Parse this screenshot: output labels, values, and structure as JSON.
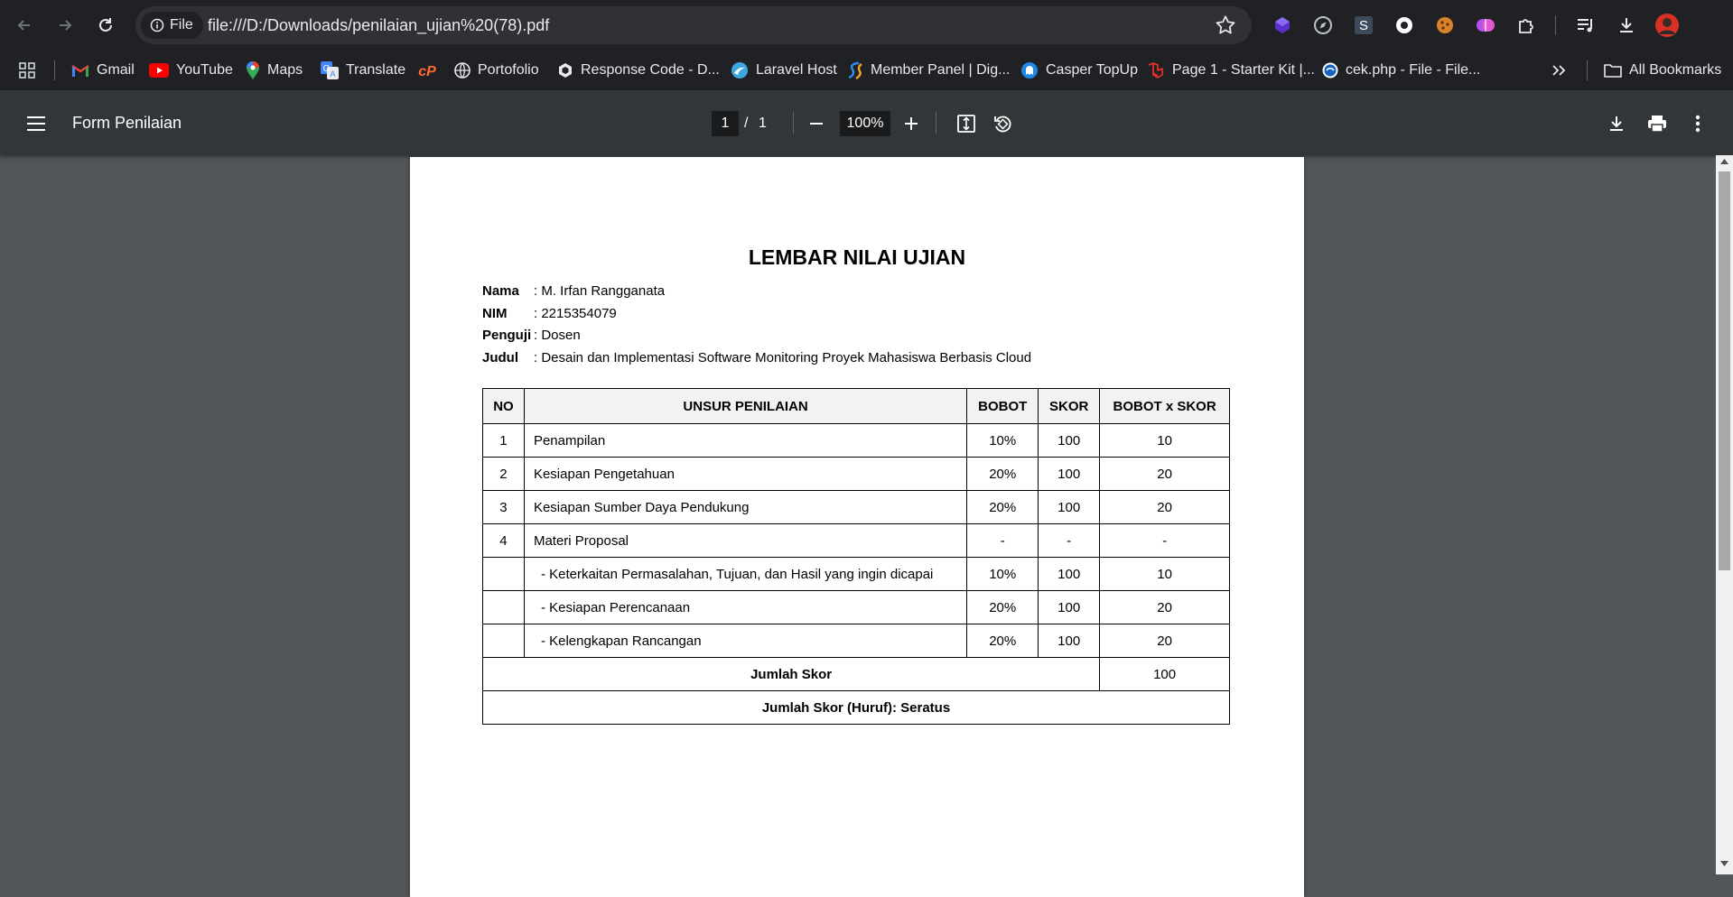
{
  "browser": {
    "url_chip": "File",
    "url": "file:///D:/Downloads/penilaian_ujian%20(78).pdf"
  },
  "bookmarks": {
    "items": [
      {
        "label": "Gmail",
        "icon": "gmail-icon"
      },
      {
        "label": "YouTube",
        "icon": "youtube-icon"
      },
      {
        "label": "Maps",
        "icon": "maps-icon"
      },
      {
        "label": "Translate",
        "icon": "translate-icon"
      },
      {
        "label": "",
        "icon": "cpanel-icon"
      },
      {
        "label": "Portofolio",
        "icon": "globe-icon"
      },
      {
        "label": "Response Code - D...",
        "icon": "response-code-icon"
      },
      {
        "label": "Laravel Host",
        "icon": "laravel-host-icon"
      },
      {
        "label": "Member Panel | Dig...",
        "icon": "member-panel-icon"
      },
      {
        "label": "Casper TopUp",
        "icon": "casper-icon"
      },
      {
        "label": "Page 1 - Starter Kit |...",
        "icon": "laravel-icon"
      },
      {
        "label": "cek.php - File - File...",
        "icon": "file-icon"
      }
    ],
    "all_bookmarks": "All Bookmarks"
  },
  "pdf_toolbar": {
    "title": "Form Penilaian",
    "page_current": "1",
    "page_separator": "/",
    "page_total": "1",
    "zoom": "100%"
  },
  "document": {
    "heading": "LEMBAR NILAI UJIAN",
    "fields": [
      {
        "label": "Nama",
        "value": ": M. Irfan Rangganata"
      },
      {
        "label": "NIM",
        "value": ": 2215354079"
      },
      {
        "label": "Penguji",
        "value": ": Dosen"
      },
      {
        "label": "Judul",
        "value": ": Desain dan Implementasi Software Monitoring Proyek Mahasiswa Berbasis Cloud"
      }
    ],
    "table": {
      "headers": [
        "NO",
        "UNSUR PENILAIAN",
        "BOBOT",
        "SKOR",
        "BOBOT x SKOR"
      ],
      "rows": [
        [
          "1",
          "Penampilan",
          "10%",
          "100",
          "10"
        ],
        [
          "2",
          "Kesiapan Pengetahuan",
          "20%",
          "100",
          "20"
        ],
        [
          "3",
          "Kesiapan Sumber Daya Pendukung",
          "20%",
          "100",
          "20"
        ],
        [
          "4",
          "Materi Proposal",
          "-",
          "-",
          "-"
        ],
        [
          "",
          "- Keterkaitan Permasalahan, Tujuan, dan Hasil yang ingin dicapai",
          "10%",
          "100",
          "10"
        ],
        [
          "",
          "- Kesiapan Perencanaan",
          "20%",
          "100",
          "20"
        ],
        [
          "",
          "- Kelengkapan Rancangan",
          "20%",
          "100",
          "20"
        ]
      ],
      "total_label": "Jumlah Skor",
      "total_value": "100",
      "total_words": "Jumlah Skor (Huruf): Seratus"
    }
  },
  "colors": {
    "browser_bg": "#202124",
    "omnibox_bg": "#303134",
    "pdf_toolbar_bg": "#323639",
    "viewer_bg": "#525659",
    "table_header_bg": "#f2f2f2"
  }
}
